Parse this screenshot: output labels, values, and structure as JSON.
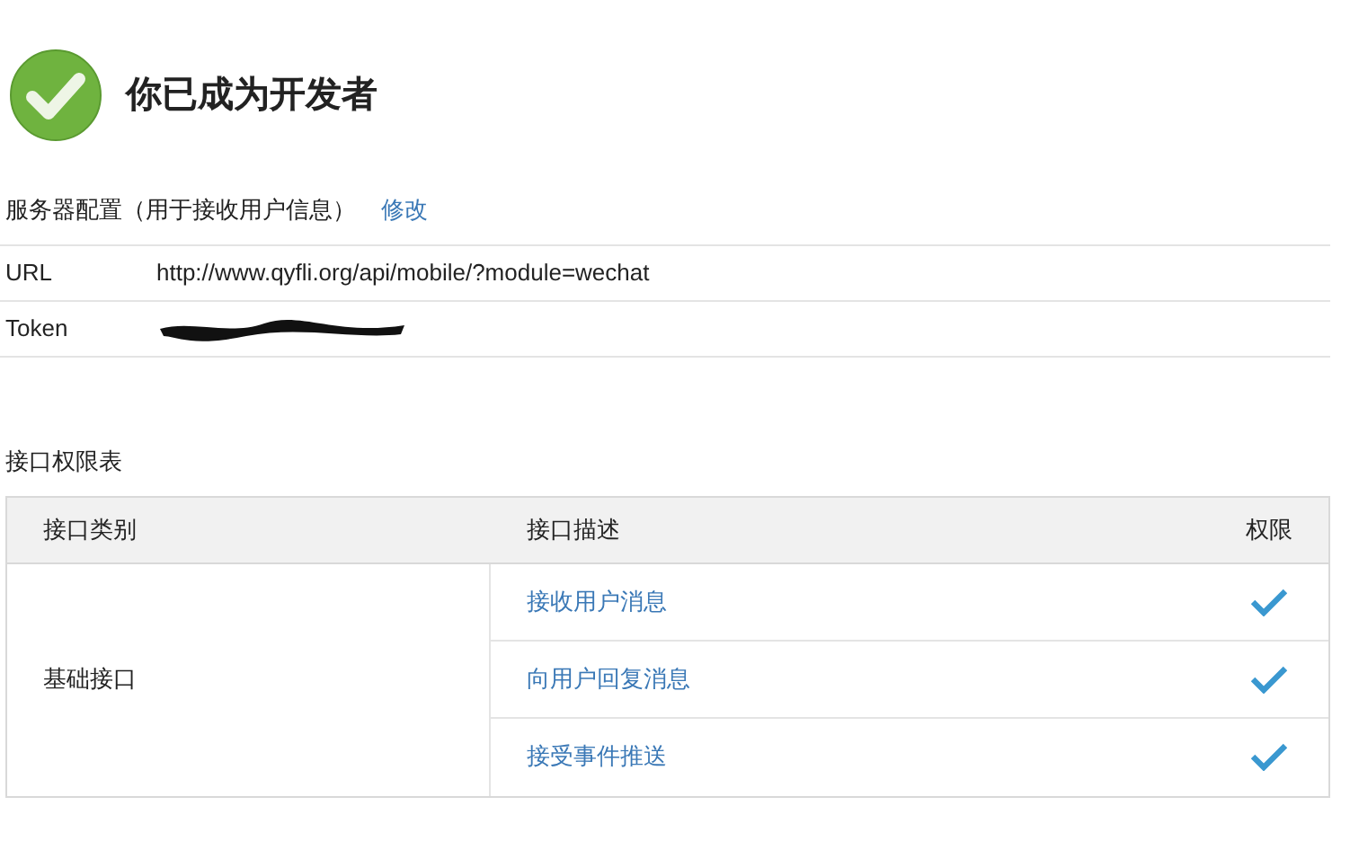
{
  "header": {
    "title": "你已成为开发者"
  },
  "server_config": {
    "label": "服务器配置（用于接收用户信息）",
    "edit_link": "修改",
    "fields": [
      {
        "label": "URL",
        "kind": "text",
        "value": "http://www.qyfli.org/api/mobile/?module=wechat"
      },
      {
        "label": "Token",
        "kind": "redacted"
      }
    ]
  },
  "permissions": {
    "label": "接口权限表",
    "columns": [
      "接口类别",
      "接口描述",
      "权限"
    ],
    "groups": [
      {
        "category": "基础接口",
        "rows": [
          {
            "description": "接收用户消息",
            "granted": true
          },
          {
            "description": "向用户回复消息",
            "granted": true
          },
          {
            "description": "接受事件推送",
            "granted": true
          }
        ]
      }
    ]
  }
}
